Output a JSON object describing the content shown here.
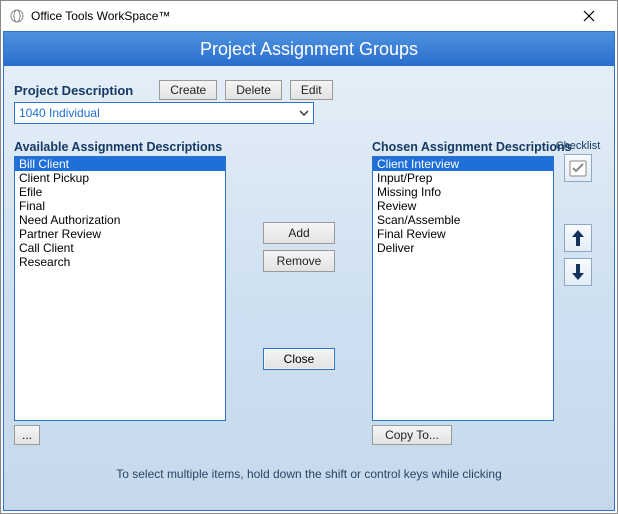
{
  "title": "Office Tools WorkSpace™",
  "page_title": "Project Assignment Groups",
  "labels": {
    "project_desc": "Project Description",
    "available": "Available Assignment Descriptions",
    "chosen": "Chosen Assignment Descriptions",
    "checklist": "Checklist"
  },
  "buttons": {
    "create": "Create",
    "delete": "Delete",
    "edit": "Edit",
    "add": "Add",
    "remove": "Remove",
    "close": "Close",
    "copy_to": "Copy To...",
    "more": "..."
  },
  "project": {
    "selected": "1040 Individual"
  },
  "available": {
    "selected_index": 0,
    "items": [
      "Bill Client",
      "Client Pickup",
      "Efile",
      "Final",
      "Need Authorization",
      "Partner Review",
      "Call Client",
      "Research"
    ]
  },
  "chosen": {
    "selected_index": 0,
    "items": [
      "Client Interview",
      "Input/Prep",
      "Missing Info",
      "Review",
      "Scan/Assemble",
      "Final Review",
      "Deliver"
    ]
  },
  "hint": "To select multiple items, hold down the shift or control keys while clicking"
}
